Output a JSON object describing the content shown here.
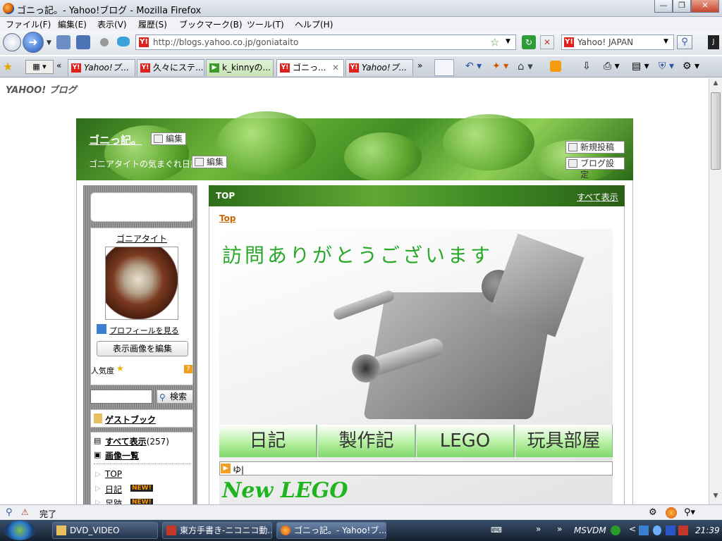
{
  "window": {
    "title": "ゴニっ記。- Yahoo!ブログ - Mozilla Firefox"
  },
  "menubar": [
    "ファイル(F)",
    "編集(E)",
    "表示(V)",
    "履歴(S)",
    "ブックマーク(B)",
    "ツール(T)",
    "ヘルプ(H)"
  ],
  "address": {
    "url": "http://blogs.yahoo.co.jp/goniataito"
  },
  "search": {
    "engine": "Yahoo! JAPAN"
  },
  "tabs": [
    {
      "label": "Yahoo!ブ...",
      "active": false
    },
    {
      "label": "久々にステ...",
      "active": false
    },
    {
      "label": "k_kinnyの...",
      "active": false
    },
    {
      "label": "ゴニっ...",
      "active": true
    },
    {
      "label": "Yahoo!ブ...",
      "active": false
    }
  ],
  "blog": {
    "logo": "YAHOO! ブログ",
    "title": "ゴニっ記。",
    "subtitle": "ゴニアタイトの気まぐれ日記",
    "edit_label": "編集",
    "new_post": "新規投稿",
    "settings": "ブログ設定"
  },
  "sidebar": {
    "username": "ゴニアタイト",
    "profile_link": "プロフィールを見る",
    "edit_image": "表示画像を編集",
    "popularity": "人気度",
    "search_button": "検索",
    "guestbook": "ゲストブック",
    "show_all": "すべて表示",
    "show_all_count": "(257)",
    "image_list": "画像一覧",
    "categories": [
      {
        "label": "TOP",
        "new": ""
      },
      {
        "label": "日記",
        "new": "NEW!"
      },
      {
        "label": "足跡",
        "new": "NEW!"
      }
    ]
  },
  "main": {
    "header": "TOP",
    "show_all": "すべて表示",
    "breadcrumb": "Top",
    "welcome": "訪問ありがとうございます",
    "menu_buttons": [
      "日記",
      "製作記",
      "LEGO",
      "玩具部屋"
    ],
    "input_value": "ゆ|",
    "new_lego": "New LEGO"
  },
  "status": {
    "text": "完了"
  },
  "taskbar": {
    "items": [
      "DVD_VIDEO",
      "東方手書き-ニコニコ動...",
      "ゴニっ記。- Yahoo!ブ..."
    ],
    "tray_label": "MSVDM",
    "clock": "21:39"
  },
  "colors": {
    "blog_green": "#3e8b22",
    "link_orange": "#cc6600",
    "welcome_green": "#2aa82a",
    "new_badge": "#ff9900"
  }
}
